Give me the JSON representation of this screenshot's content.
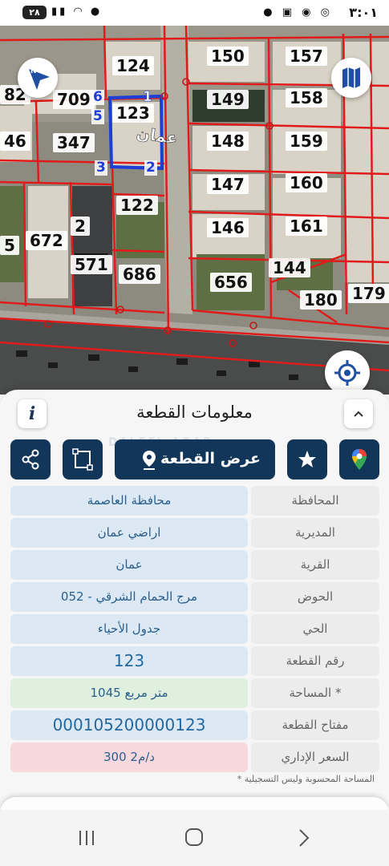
{
  "status_bar": {
    "time": "٣:٠١",
    "battery": "٢٨"
  },
  "map": {
    "street_label": "عمان",
    "parcels": [
      {
        "id": "124"
      },
      {
        "id": "150"
      },
      {
        "id": "157"
      },
      {
        "id": "82"
      },
      {
        "id": "709"
      },
      {
        "id": "123"
      },
      {
        "id": "149"
      },
      {
        "id": "158"
      },
      {
        "id": "46"
      },
      {
        "id": "347"
      },
      {
        "id": "148"
      },
      {
        "id": "159"
      },
      {
        "id": "147"
      },
      {
        "id": "160"
      },
      {
        "id": "122"
      },
      {
        "id": "2"
      },
      {
        "id": "672"
      },
      {
        "id": "146"
      },
      {
        "id": "161"
      },
      {
        "id": "5"
      },
      {
        "id": "571"
      },
      {
        "id": "686"
      },
      {
        "id": "144"
      },
      {
        "id": "656"
      },
      {
        "id": "179"
      },
      {
        "id": "180"
      }
    ],
    "vertices": [
      {
        "id": "1"
      },
      {
        "id": "6"
      },
      {
        "id": "5"
      },
      {
        "id": "3"
      },
      {
        "id": "2"
      }
    ]
  },
  "panel": {
    "title": "معلومات القطعة",
    "info_label": "i",
    "show_parcel_label": "عرض القطعة",
    "watermark": "DALEEL AQAR",
    "rows": [
      {
        "label": "المحافظة",
        "value": "محافظة العاصمة"
      },
      {
        "label": "المديرية",
        "value": "اراضي عمان"
      },
      {
        "label": "القرية",
        "value": "عمان"
      },
      {
        "label": "الحوض",
        "value": "مرج الحمام الشرقي - 052"
      },
      {
        "label": "الحي",
        "value": "جدول الأحياء"
      },
      {
        "label": "رقم القطعة",
        "value": "123"
      },
      {
        "label": "المساحة *",
        "value": "1045  متر مربع"
      },
      {
        "label": "مفتاح القطعة",
        "value": "000105200000123"
      },
      {
        "label": "السعر الإداري",
        "value": "300 د/م2"
      }
    ],
    "footnote": "* المساحة المحسوبة وليس التسجيلية"
  },
  "colors": {
    "primary": "#12365a",
    "value_bg": "#dce9f4",
    "area_bg": "#dff0df",
    "price_bg": "#f7d9dd",
    "parcel_lines": "#e01b1b",
    "selection": "#1d3fd6"
  }
}
